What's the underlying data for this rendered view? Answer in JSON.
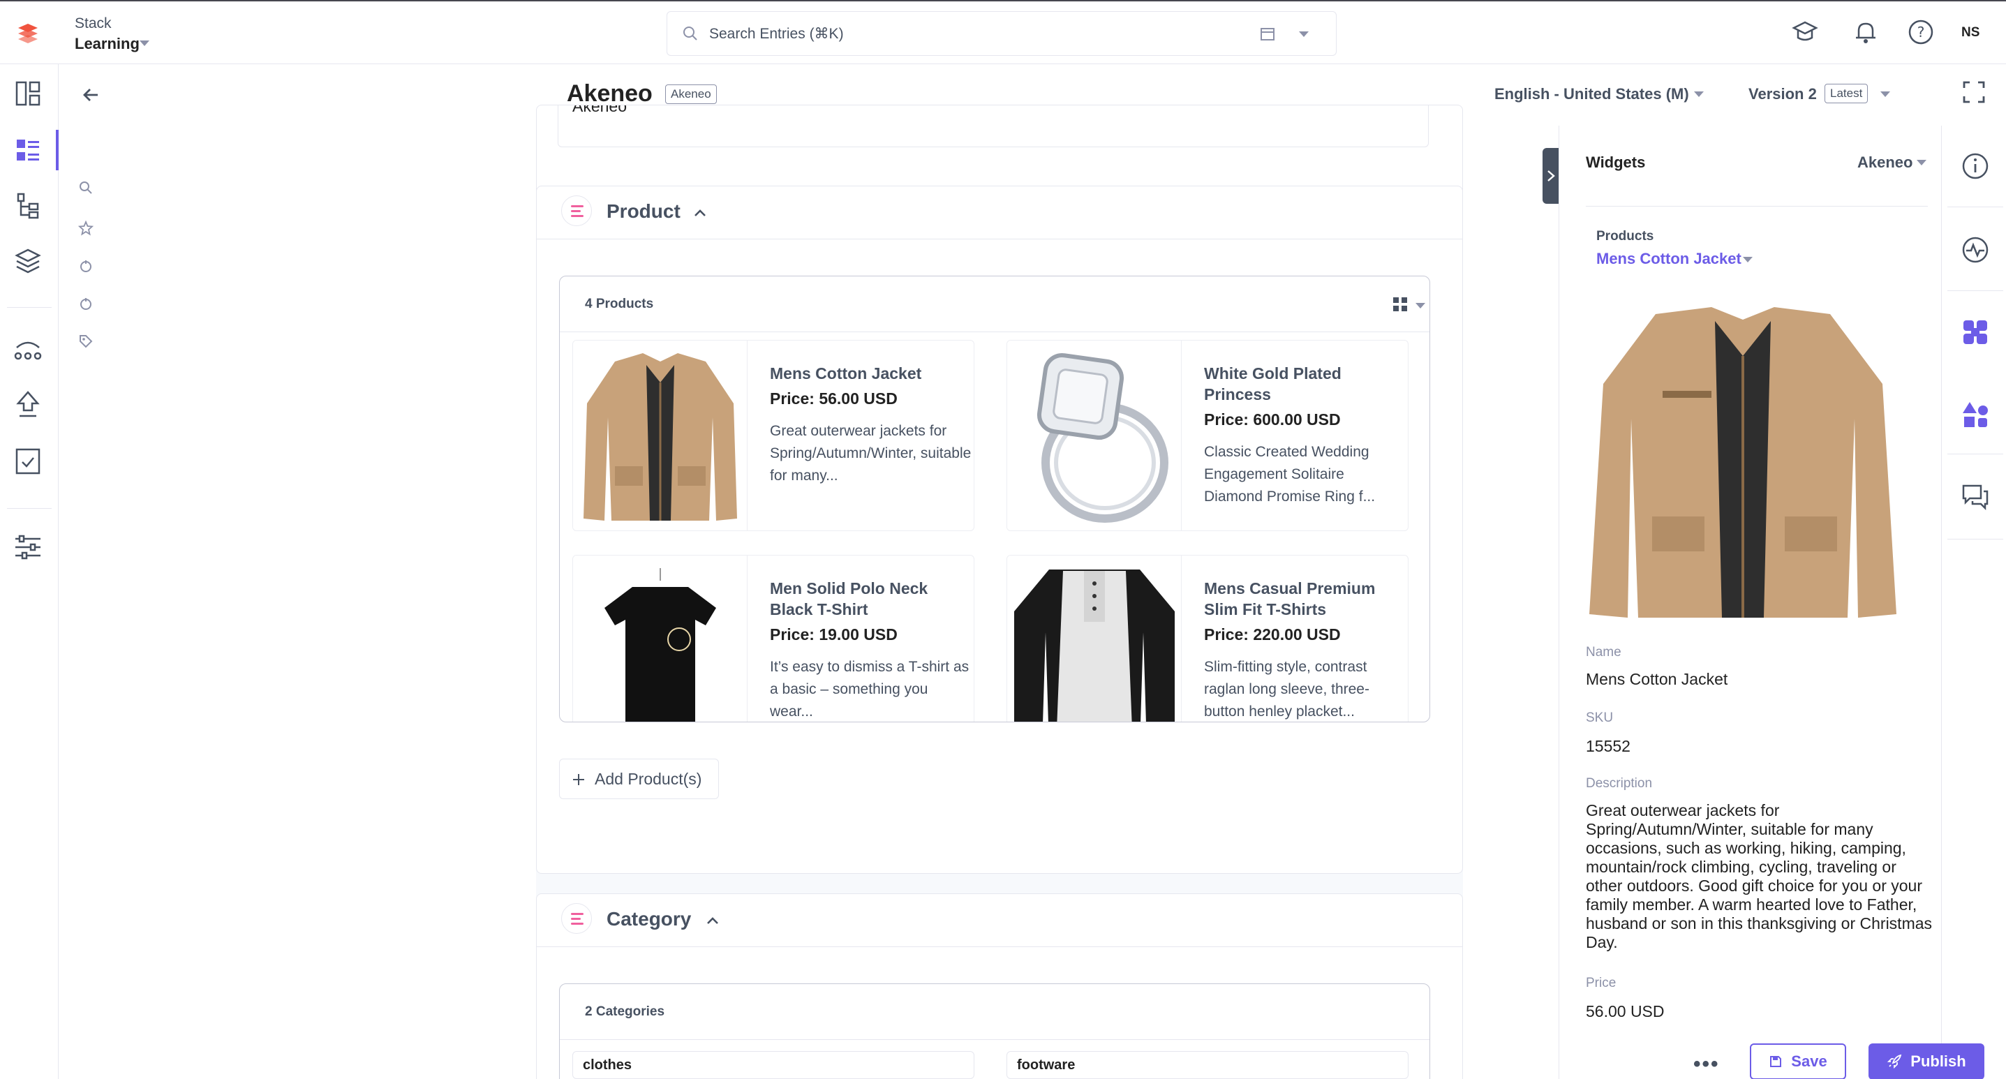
{
  "app": {
    "stack_name": "Stack",
    "stack_branch": "Learning",
    "user_initials": "NS"
  },
  "search": {
    "placeholder": "Search Entries (⌘K)"
  },
  "entry": {
    "title": "Akeneo",
    "badge": "Akeneo",
    "locale": "English - United States (M)",
    "version": "Version 2",
    "version_badge": "Latest",
    "previous_field_value": "Akeneo"
  },
  "product_section": {
    "title": "Product",
    "count_label": "4 Products",
    "add_label": "Add Product(s)",
    "products": [
      {
        "name": "Mens Cotton Jacket",
        "price": "Price: 56.00 USD",
        "description": "Great outerwear jackets for Spring/Autumn/Winter, suitable for many..."
      },
      {
        "name": "White Gold Plated Princess",
        "price": "Price: 600.00 USD",
        "description": "Classic Created Wedding Engagement Solitaire Diamond Promise Ring f..."
      },
      {
        "name": "Men Solid Polo Neck Black T-Shirt",
        "price": "Price: 19.00 USD",
        "description": "It’s easy to dismiss a T-shirt as a basic – something you wear..."
      },
      {
        "name": "Mens Casual Premium Slim Fit T-Shirts",
        "price": "Price: 220.00 USD",
        "description": "Slim-fitting style, contrast raglan long sleeve, three-button henley placket..."
      }
    ]
  },
  "category_section": {
    "title": "Category",
    "count_label": "2 Categories",
    "categories": [
      "clothes",
      "footware"
    ]
  },
  "widgets": {
    "title": "Widgets",
    "selected": "Akeneo",
    "products_label": "Products",
    "selected_product": "Mens Cotton Jacket",
    "fields": {
      "name_label": "Name",
      "name_value": "Mens Cotton Jacket",
      "sku_label": "SKU",
      "sku_value": "15552",
      "description_label": "Description",
      "description_value": "Great outerwear jackets for Spring/Autumn/Winter, suitable for many occasions, such as working, hiking, camping, mountain/rock climbing, cycling, traveling or other outdoors. Good gift choice for you or your family member. A warm hearted love to Father, husband or son in this thanksgiving or Christmas Day.",
      "price_label": "Price",
      "price_value": "56.00 USD"
    }
  },
  "actions": {
    "more": "•••",
    "save": "Save",
    "publish": "Publish"
  },
  "colors": {
    "accent": "#6c5ce7",
    "logo": "#f0533e",
    "text_muted": "#475161",
    "border": "#e6e7ef"
  },
  "icons": {
    "left_nav": [
      "dashboard-icon",
      "entries-icon",
      "content-models-icon",
      "assets-icon",
      "releases-icon",
      "deploy-icon",
      "tasks-icon",
      "settings-icon"
    ],
    "right_rail": [
      "info-icon",
      "activity-icon",
      "widgets-icon",
      "shapes-icon",
      "comments-icon"
    ]
  }
}
